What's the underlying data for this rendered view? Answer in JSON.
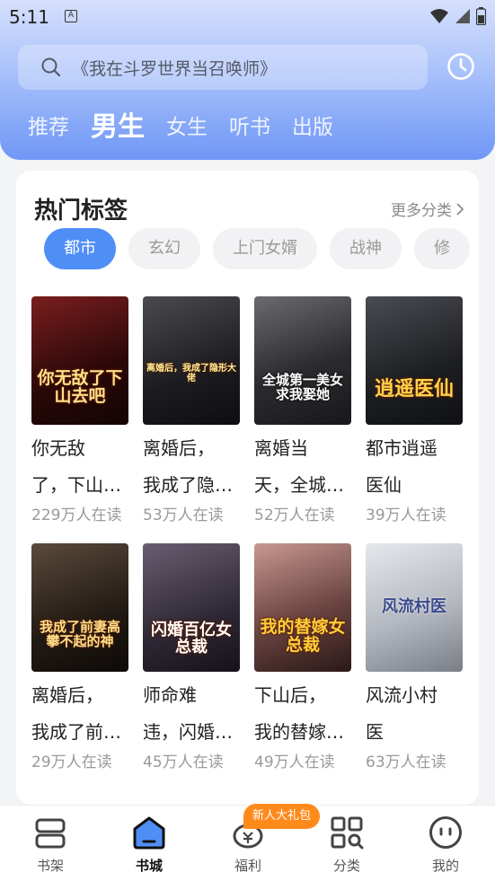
{
  "status_bar": {
    "time": "5:11",
    "notification": "A"
  },
  "search": {
    "placeholder": "《我在斗罗世界当召唤师》"
  },
  "tabs": [
    {
      "label": "推荐",
      "active": false
    },
    {
      "label": "男生",
      "active": true
    },
    {
      "label": "女生",
      "active": false
    },
    {
      "label": "听书",
      "active": false
    },
    {
      "label": "出版",
      "active": false
    }
  ],
  "section": {
    "title": "热门标签",
    "more": "更多分类"
  },
  "chips": [
    {
      "label": "都市",
      "active": true
    },
    {
      "label": "玄幻",
      "active": false
    },
    {
      "label": "上门女婿",
      "active": false
    },
    {
      "label": "战神",
      "active": false
    },
    {
      "label": "修",
      "active": false
    }
  ],
  "books": [
    {
      "title_line1": "你无敌",
      "title_line2": "了，下山…",
      "readers": "229万人在读",
      "cover_text": "你无敌了下山去吧",
      "cover_color": "#5a1414"
    },
    {
      "title_line1": "离婚后，",
      "title_line2": "我成了隐…",
      "readers": "53万人在读",
      "cover_text": "离婚后，我成了隐形大佬",
      "cover_color": "#2b2b30"
    },
    {
      "title_line1": "离婚当",
      "title_line2": "天，全城…",
      "readers": "52万人在读",
      "cover_text": "全城第一美女求我娶她",
      "cover_color": "#3a3a3e"
    },
    {
      "title_line1": "都市逍遥",
      "title_line2": "医仙",
      "readers": "39万人在读",
      "cover_text": "逍遥医仙",
      "cover_color": "#2a2c30"
    },
    {
      "title_line1": "离婚后，",
      "title_line2": "我成了前…",
      "readers": "29万人在读",
      "cover_text": "我成了前妻高攀不起的神",
      "cover_color": "#2a2520"
    },
    {
      "title_line1": "师命难",
      "title_line2": "违，闪婚…",
      "readers": "45万人在读",
      "cover_text": "闪婚百亿女总裁",
      "cover_color": "#3b3440"
    },
    {
      "title_line1": "下山后，",
      "title_line2": "我的替嫁…",
      "readers": "49万人在读",
      "cover_text": "我的替嫁女总裁",
      "cover_color": "#5a3a38"
    },
    {
      "title_line1": "风流小村",
      "title_line2": "医",
      "readers": "63万人在读",
      "cover_text": "风流村医",
      "cover_color": "#9aa0a8"
    }
  ],
  "nav": [
    {
      "label": "书架",
      "icon": "bookshelf-icon",
      "active": false
    },
    {
      "label": "书城",
      "icon": "bookstore-icon",
      "active": true
    },
    {
      "label": "福利",
      "icon": "gift-icon",
      "active": false
    },
    {
      "label": "分类",
      "icon": "category-icon",
      "active": false
    },
    {
      "label": "我的",
      "icon": "profile-icon",
      "active": false
    }
  ],
  "nav_badge": "新人大礼包",
  "colors": {
    "accent": "#4f8ef5",
    "badge": "#ff8a1c"
  }
}
